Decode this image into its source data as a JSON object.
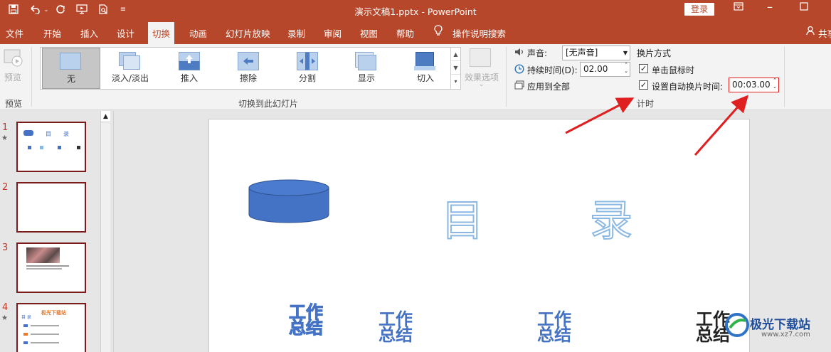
{
  "titlebar": {
    "doc_title": "演示文稿1.pptx  -  PowerPoint",
    "login_label": "登录"
  },
  "tabs": [
    {
      "label": "文件"
    },
    {
      "label": "开始"
    },
    {
      "label": "插入"
    },
    {
      "label": "设计"
    },
    {
      "label": "切换",
      "active": true
    },
    {
      "label": "动画"
    },
    {
      "label": "幻灯片放映"
    },
    {
      "label": "录制"
    },
    {
      "label": "审阅"
    },
    {
      "label": "视图"
    },
    {
      "label": "帮助"
    },
    {
      "label": "操作说明搜索"
    },
    {
      "label": "共享"
    }
  ],
  "ribbon": {
    "preview_label": "预览",
    "preview_group_label": "预览",
    "transitions": [
      {
        "label": "无",
        "selected": true
      },
      {
        "label": "淡入/淡出"
      },
      {
        "label": "推入"
      },
      {
        "label": "擦除"
      },
      {
        "label": "分割"
      },
      {
        "label": "显示"
      },
      {
        "label": "切入"
      }
    ],
    "transitions_group_label": "切换到此幻灯片",
    "effect_options_label": "效果选项",
    "sound_label": "声音:",
    "sound_value": "[无声音]",
    "duration_label": "持续时间(D):",
    "duration_value": "02.00",
    "apply_all_label": "应用到全部",
    "advance_header": "换片方式",
    "on_click_label": "单击鼠标时",
    "on_click_checked": true,
    "auto_after_label": "设置自动换片时间:",
    "auto_after_checked": true,
    "auto_after_value": "00:03.00",
    "timing_group_label": "计时"
  },
  "slides": [
    {
      "number": "1",
      "starred": true,
      "heading_1": "目",
      "heading_2": "录"
    },
    {
      "number": "2",
      "starred": false
    },
    {
      "number": "3",
      "starred": false
    },
    {
      "number": "4",
      "starred": true,
      "title": "极光下载站",
      "toc": "目 录"
    }
  ],
  "main_slide": {
    "char_1": "目",
    "char_2": "录",
    "words": [
      "工作\n总结",
      "工作\n总结",
      "工作\n总结",
      "工作\n总结"
    ]
  },
  "watermark": {
    "text": "极光下载站",
    "url": "www.xz7.com"
  },
  "colors": {
    "accent": "#b7472a",
    "arrow": "#e02020",
    "shape_blue": "#4472c4"
  }
}
